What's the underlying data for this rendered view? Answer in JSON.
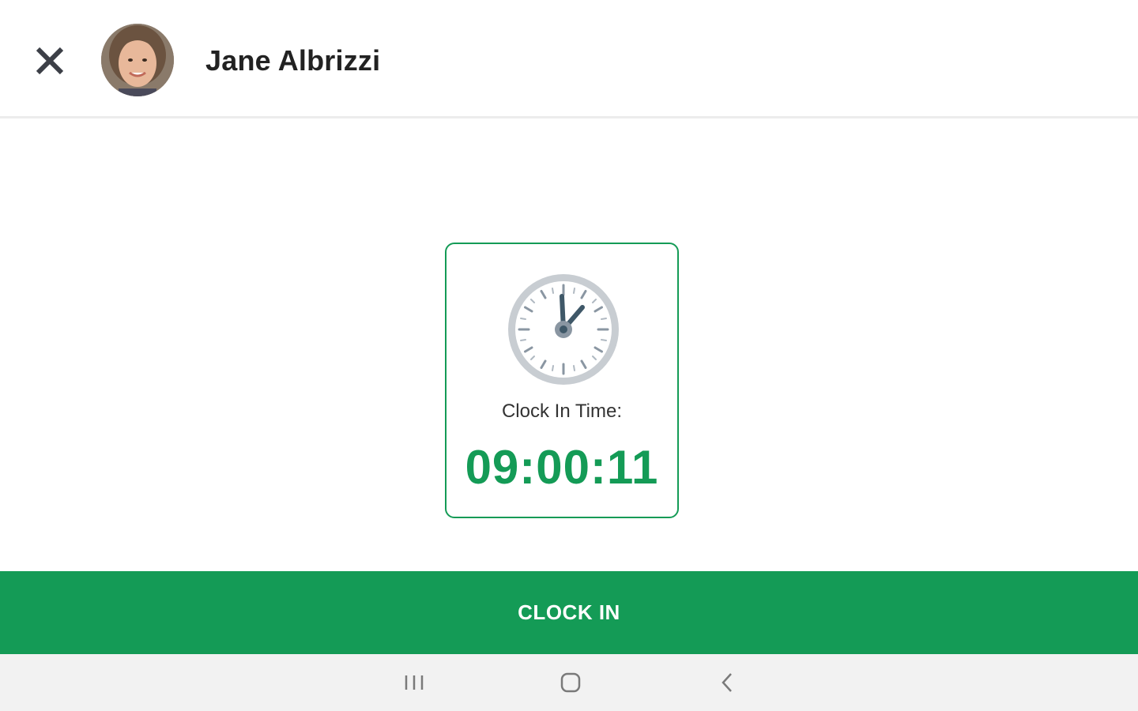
{
  "header": {
    "close_icon": "close-icon",
    "avatar_icon": "user-avatar",
    "user_name": "Jane Albrizzi"
  },
  "card": {
    "icon": "clock-icon",
    "label": "Clock In Time:",
    "time": "09:00:11"
  },
  "actions": {
    "clock_in_label": "CLOCK IN"
  },
  "navbar": {
    "recents_icon": "recent-apps-icon",
    "home_icon": "home-icon",
    "back_icon": "back-icon"
  },
  "colors": {
    "accent": "#149b56",
    "text_dark": "#222222",
    "navbar_bg": "#f2f2f2"
  }
}
